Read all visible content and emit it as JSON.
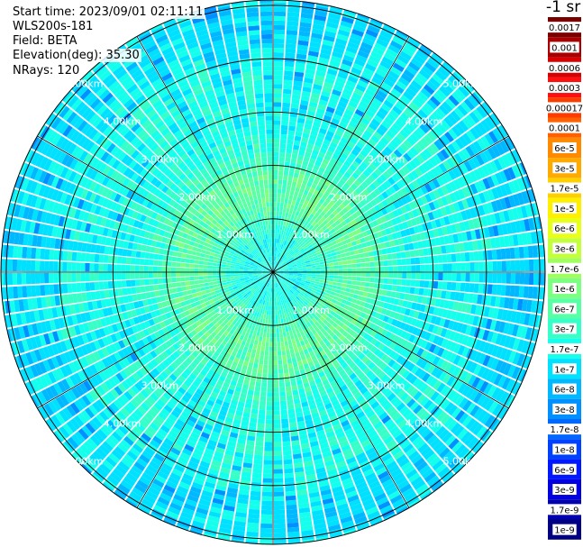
{
  "info": {
    "start_time": "Start time: 2023/09/01 02:11:11",
    "instrument": "WLS200s-181",
    "field": "Field: BETA",
    "elevation": "Elevation(deg): 35.30",
    "nrays": "NRays: 120"
  },
  "colorbar": {
    "unit": "-1 sr",
    "labels": [
      "0.0017",
      "0.001",
      "0.0006",
      "0.0003",
      "0.00017",
      "0.0001",
      "6e-5",
      "3e-5",
      "1.7e-5",
      "1e-5",
      "6e-6",
      "3e-6",
      "1.7e-6",
      "1e-6",
      "6e-7",
      "3e-7",
      "1.7e-7",
      "1e-7",
      "6e-8",
      "3e-8",
      "1.7e-8",
      "1e-8",
      "6e-9",
      "3e-9",
      "1.7e-9",
      "1e-9"
    ],
    "colors": [
      "#7a0000",
      "#a80000",
      "#d80000",
      "#ff1010",
      "#ff3c00",
      "#ff6000",
      "#ff8a00",
      "#ffaa00",
      "#ffd000",
      "#fff000",
      "#e8ff1a",
      "#c4ff3e",
      "#a0ff60",
      "#7cff82",
      "#58ffa4",
      "#36ffc8",
      "#14ffec",
      "#00e0ff",
      "#00b8ff",
      "#0090ff",
      "#0068ff",
      "#0040ff",
      "#0018ff",
      "#0000e0",
      "#0000b0",
      "#000080"
    ]
  },
  "chart_data": {
    "type": "heatmap",
    "projection": "polar-ppi",
    "field": "BETA",
    "nrays": 120,
    "range_rings_km": [
      1,
      2,
      3,
      4,
      5
    ],
    "range_labels": [
      "1.00km",
      "2.00km",
      "3.00km",
      "4.00km",
      "5.00km"
    ],
    "max_range_km": 5.1,
    "spoke_step_deg": 30,
    "profile": {
      "range_km": [
        0.0,
        0.5,
        0.9,
        1.3,
        1.7,
        2.1,
        2.6,
        3.2,
        3.8,
        4.4,
        5.1
      ],
      "dominant_color_index": [
        16,
        16,
        15,
        14,
        14,
        15,
        16,
        16,
        16,
        17,
        17
      ]
    }
  }
}
